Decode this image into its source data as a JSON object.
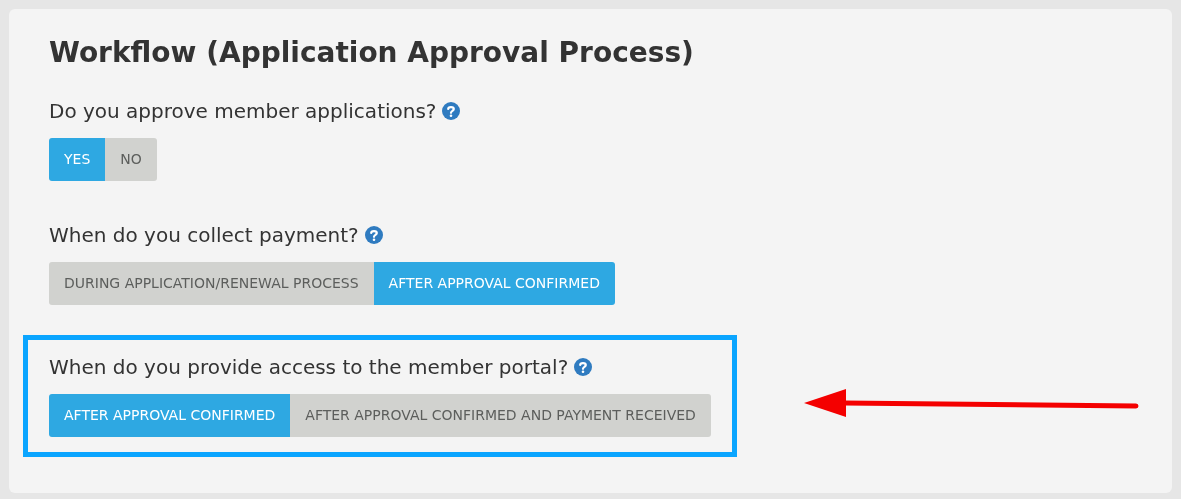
{
  "title": "Workflow (Application Approval Process)",
  "questions": [
    {
      "label": "Do you approve member applications?",
      "highlighted": false,
      "options": [
        {
          "label": "YES",
          "selected": true
        },
        {
          "label": "NO",
          "selected": false
        }
      ]
    },
    {
      "label": "When do you collect payment?",
      "highlighted": false,
      "options": [
        {
          "label": "DURING APPLICATION/RENEWAL PROCESS",
          "selected": false
        },
        {
          "label": "AFTER APPROVAL CONFIRMED",
          "selected": true
        }
      ]
    },
    {
      "label": "When do you provide access to the member portal?",
      "highlighted": true,
      "options": [
        {
          "label": "AFTER APPROVAL CONFIRMED",
          "selected": true
        },
        {
          "label": "AFTER APPROVAL CONFIRMED AND PAYMENT RECEIVED",
          "selected": false
        }
      ]
    }
  ]
}
